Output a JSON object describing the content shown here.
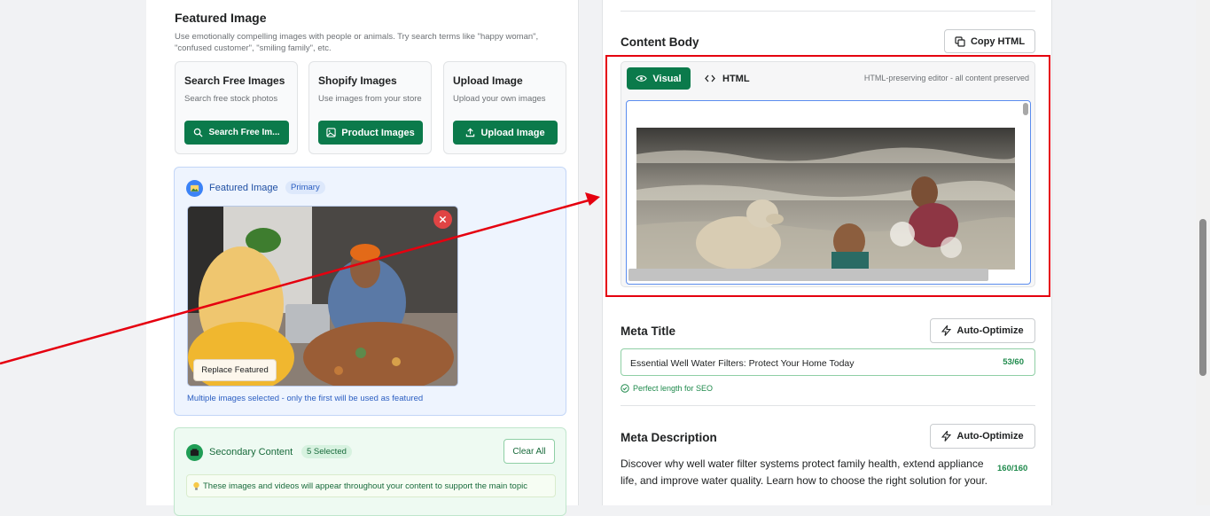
{
  "left": {
    "featured_title": "Featured Image",
    "featured_desc": "Use emotionally compelling images with people or animals. Try search terms like \"happy woman\", \"confused customer\", \"smiling family\", etc.",
    "sources": [
      {
        "title": "Search Free Images",
        "sub": "Search free stock photos",
        "button": "Search Free Im..."
      },
      {
        "title": "Shopify Images",
        "sub": "Use images from your store",
        "button": "Product Images"
      },
      {
        "title": "Upload Image",
        "sub": "Upload your own images",
        "button": "Upload Image"
      }
    ],
    "featured_panel": {
      "label": "Featured Image",
      "badge": "Primary",
      "replace_button": "Replace Featured",
      "note": "Multiple images selected - only the first will be used as featured"
    },
    "secondary": {
      "label": "Secondary Content",
      "badge": "5 Selected",
      "clear_button": "Clear All",
      "tip": "These images and videos will appear throughout your content to support the main topic"
    }
  },
  "right": {
    "content_body_title": "Content Body",
    "copy_html_button": "Copy HTML",
    "editor": {
      "tab_visual": "Visual",
      "tab_html": "HTML",
      "hint": "HTML-preserving editor - all content preserved"
    },
    "meta_title": {
      "label": "Meta Title",
      "optimize_button": "Auto-Optimize",
      "value": "Essential Well Water Filters: Protect Your Home Today",
      "count": "53/60",
      "status": "Perfect length for SEO"
    },
    "meta_description": {
      "label": "Meta Description",
      "optimize_button": "Auto-Optimize",
      "value": "Discover why well water filter systems protect family health, extend appliance life, and improve water quality. Learn how to choose the right solution for your.",
      "count": "160/160"
    }
  },
  "colors": {
    "accent_green": "#0b7a4b",
    "annotation_red": "#e5000f",
    "blue_panel": "#eef4fe",
    "green_panel": "#eefaf2"
  }
}
